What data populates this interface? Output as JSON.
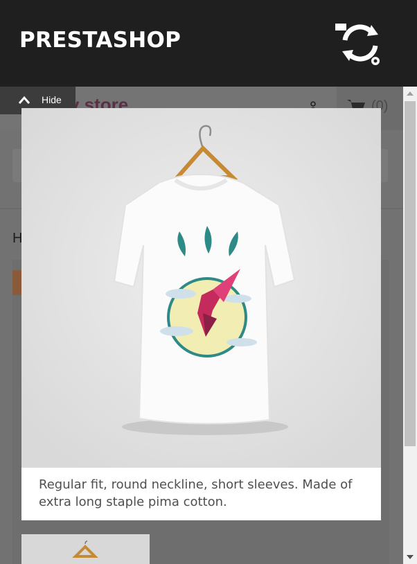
{
  "topbar": {
    "brand": "PRESTASHOP",
    "sync_icon": "store-sync-gear-icon"
  },
  "background_page": {
    "logo_partial": "y store",
    "cart_count": "(0)",
    "breadcrumb_partial": "H"
  },
  "hide_tab": {
    "label": "Hide",
    "icon": "chevron-up-icon"
  },
  "modal": {
    "image": "hummingbird-tshirt-image",
    "caption": "Regular fit, round neckline, short sleeves. Made of extra long staple pima cotton."
  },
  "colors": {
    "topbar": "#1f1f1f",
    "overlay": "#727272",
    "teal": "#2e8a86",
    "magenta": "#c42a5c",
    "sun": "#f2eeb3"
  }
}
